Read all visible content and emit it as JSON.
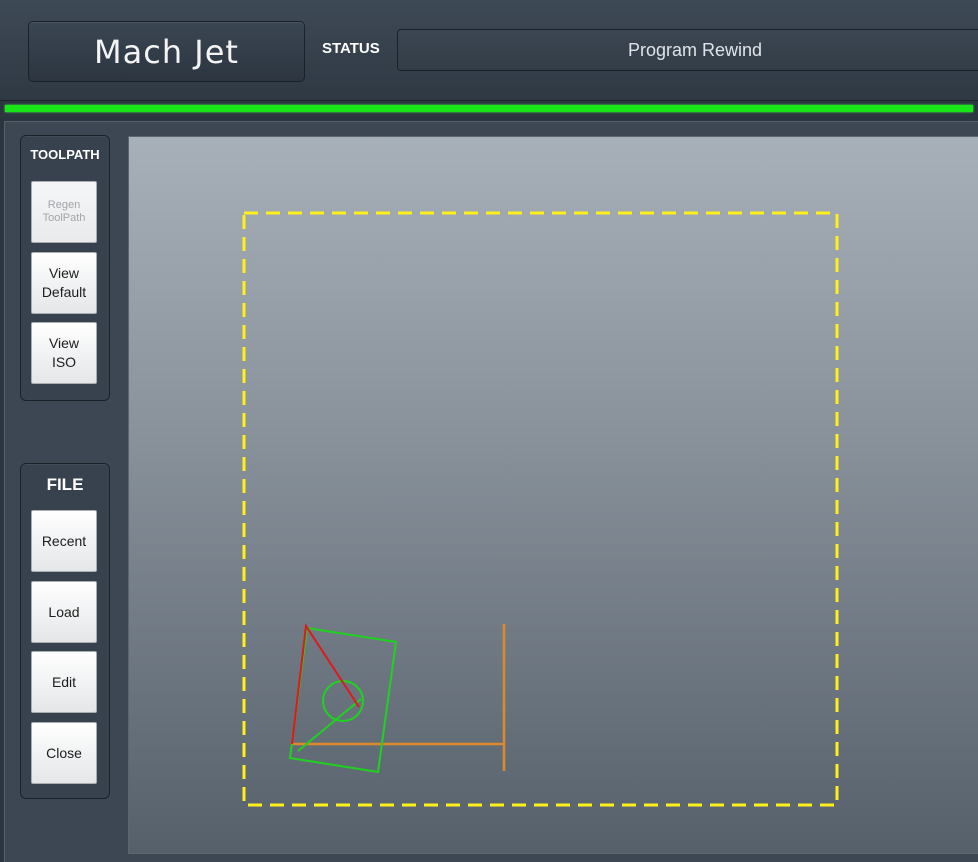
{
  "app": {
    "title": "Mach Jet"
  },
  "status": {
    "label": "STATUS",
    "value": "Program Rewind"
  },
  "progress": {
    "fraction": 1.0,
    "color": "#19e619"
  },
  "toolpath_panel": {
    "title": "TOOLPATH",
    "buttons": [
      "Regen\nToolPath",
      "View\nDefault",
      "View\nISO"
    ]
  },
  "file_panel": {
    "title": "FILE",
    "buttons": [
      "Recent",
      "Load",
      "Edit",
      "Close"
    ]
  },
  "viewport": {
    "colors": {
      "boundary": "#ffef1a",
      "machine_axis": "#e0892b",
      "part_outline": "#1fd21f",
      "tool_path": "#e01818"
    }
  }
}
